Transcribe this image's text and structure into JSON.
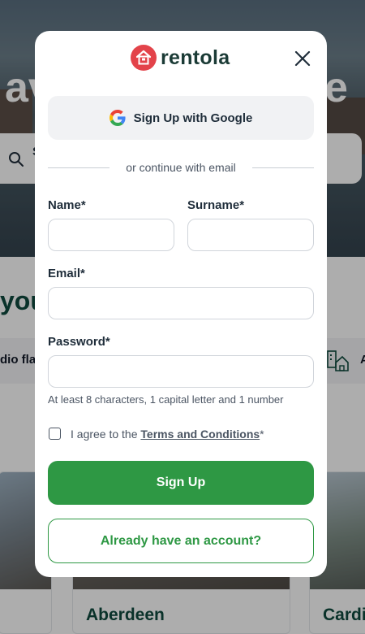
{
  "background": {
    "hero_title_left": "av",
    "hero_title_right": "e",
    "search_first_char": "S",
    "section_title": "you",
    "chips": [
      "dio fla",
      "A"
    ],
    "cities": [
      "Aberdeen",
      "Cardi"
    ]
  },
  "modal": {
    "brand_name": "rentola",
    "google_button_label": "Sign Up with Google",
    "divider_text": "or continue with email",
    "fields": {
      "name_label": "Name*",
      "name_value": "",
      "surname_label": "Surname*",
      "surname_value": "",
      "email_label": "Email*",
      "email_value": "",
      "password_label": "Password*",
      "password_value": ""
    },
    "password_hint": "At least 8 characters, 1 capital letter and 1 number",
    "terms_prefix": "I agree to the ",
    "terms_link": "Terms and Conditions",
    "terms_suffix": "*",
    "signup_button_label": "Sign Up",
    "login_button_label": "Already have an account?"
  },
  "colors": {
    "brand_red": "#e3434a",
    "primary_green": "#2e9844",
    "dark_teal": "#0f4b3f",
    "overlay": "rgba(0,0,0,0.32)"
  },
  "icons": [
    "house-logo-icon",
    "close-icon",
    "google-icon",
    "search-icon",
    "building-house-icon"
  ]
}
